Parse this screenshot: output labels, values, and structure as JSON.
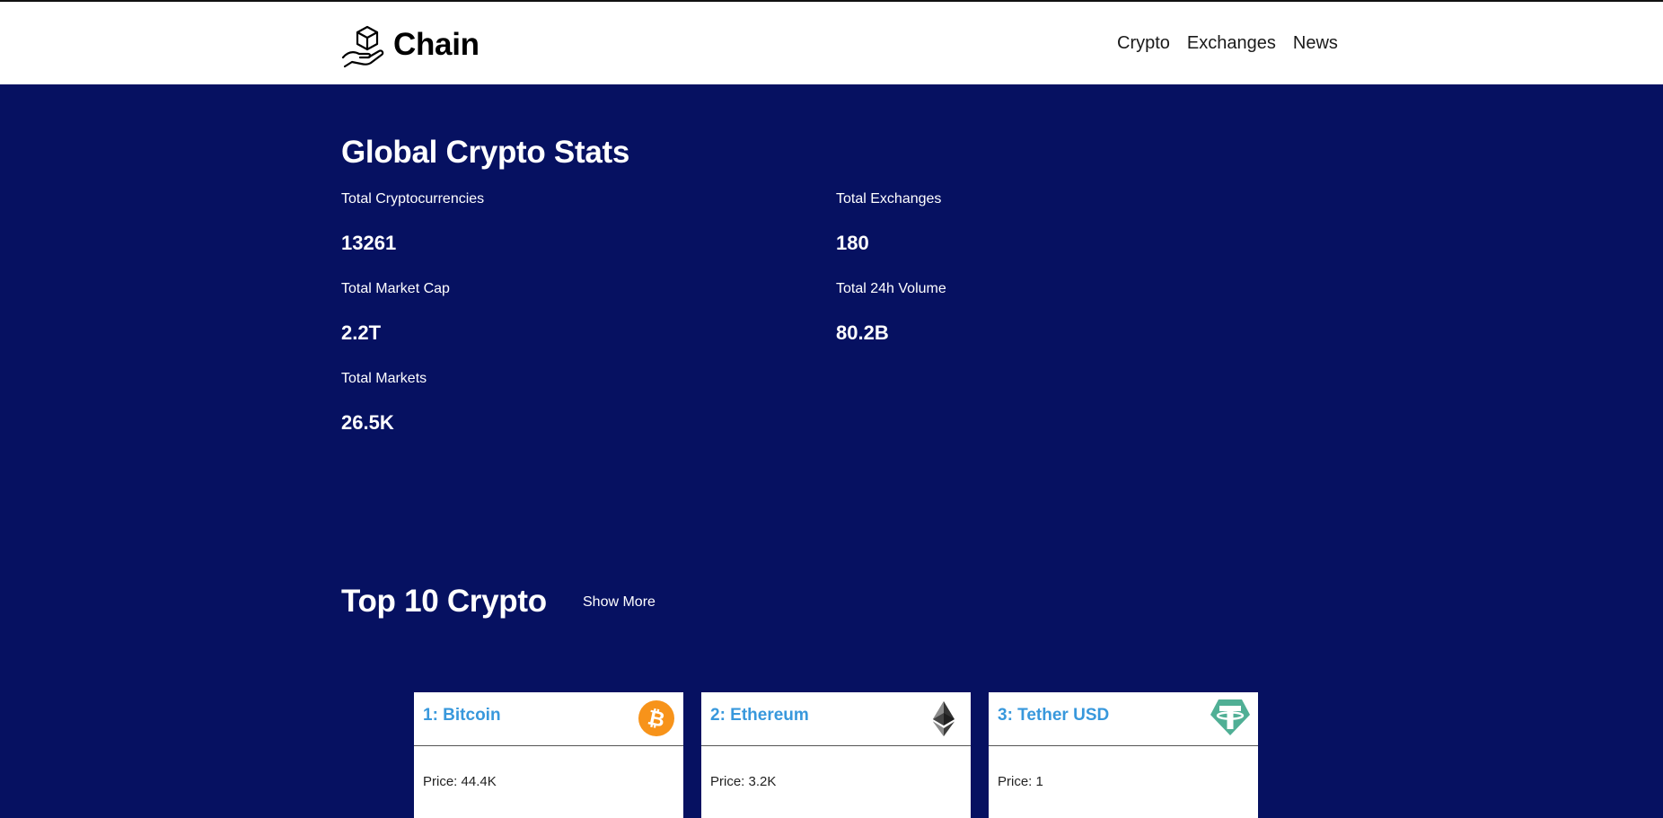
{
  "header": {
    "brand": "Chain",
    "nav": [
      "Crypto",
      "Exchanges",
      "News"
    ]
  },
  "stats": {
    "title": "Global Crypto Stats",
    "items": [
      {
        "label": "Total Cryptocurrencies",
        "value": "13261"
      },
      {
        "label": "Total Exchanges",
        "value": "180"
      },
      {
        "label": "Total Market Cap",
        "value": "2.2T"
      },
      {
        "label": "Total 24h Volume",
        "value": "80.2B"
      },
      {
        "label": "Total Markets",
        "value": "26.5K"
      }
    ]
  },
  "top": {
    "title": "Top 10 Crypto",
    "show_more": "Show More",
    "cards": [
      {
        "title": "1: Bitcoin",
        "price": "Price: 44.4K",
        "icon": "bitcoin-icon",
        "color": "#f7931a"
      },
      {
        "title": "2: Ethereum",
        "price": "Price: 3.2K",
        "icon": "ethereum-icon",
        "color": "#343434"
      },
      {
        "title": "3: Tether USD",
        "price": "Price: 1",
        "icon": "tether-icon",
        "color": "#50af95"
      }
    ]
  },
  "colors": {
    "background": "#061161",
    "card_title": "#3898dc"
  }
}
